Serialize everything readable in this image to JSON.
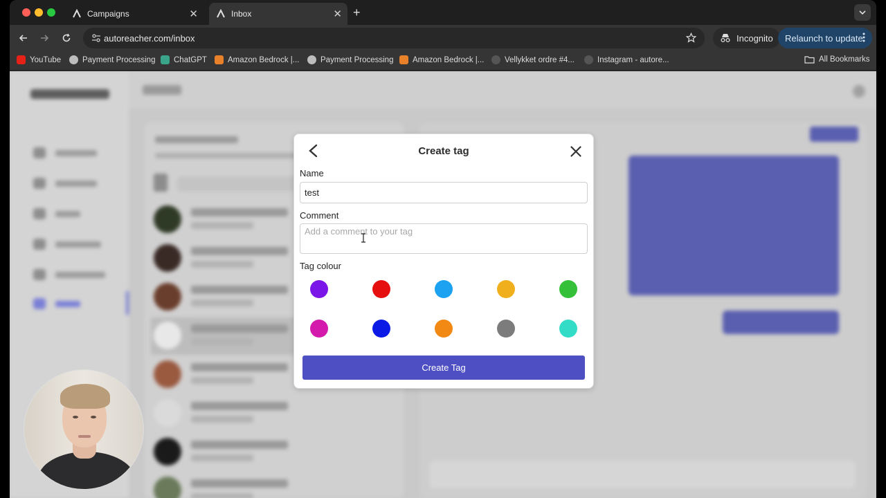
{
  "browser": {
    "tabs": [
      {
        "label": "Campaigns",
        "active": false
      },
      {
        "label": "Inbox",
        "active": true
      }
    ],
    "url": "autoreacher.com/inbox",
    "incognito_label": "Incognito",
    "relaunch_label": "Relaunch to update",
    "bookmarks": [
      {
        "label": "YouTube",
        "icon": "youtube-icon",
        "color": "#e62117"
      },
      {
        "label": "Payment Processing",
        "icon": "globe-icon",
        "color": "#bdbdbd"
      },
      {
        "label": "ChatGPT",
        "icon": "chatgpt-icon",
        "color": "#3aa58a"
      },
      {
        "label": "Amazon Bedrock |...",
        "icon": "aws-icon",
        "color": "#e8812a"
      },
      {
        "label": "Payment Processing",
        "icon": "globe-icon",
        "color": "#bdbdbd"
      },
      {
        "label": "Amazon Bedrock |...",
        "icon": "aws-icon",
        "color": "#e8812a"
      },
      {
        "label": "Vellykket ordre #4...",
        "icon": "person-icon",
        "color": "#555555"
      },
      {
        "label": "Instagram - autore...",
        "icon": "person-icon",
        "color": "#555555"
      }
    ],
    "all_bookmarks_label": "All Bookmarks"
  },
  "modal": {
    "title": "Create tag",
    "name_label": "Name",
    "name_value": "test",
    "comment_label": "Comment",
    "comment_placeholder": "Add a comment to your tag",
    "comment_value": "",
    "colour_label": "Tag colour",
    "colours": [
      "#7b16e8",
      "#e60f0f",
      "#1ca2f0",
      "#f0b01e",
      "#35c03a",
      "#d41aad",
      "#0c1ae6",
      "#f18914",
      "#7c7c7c",
      "#33dcc6"
    ],
    "submit_label": "Create Tag",
    "accent": "#4e4fc3"
  }
}
